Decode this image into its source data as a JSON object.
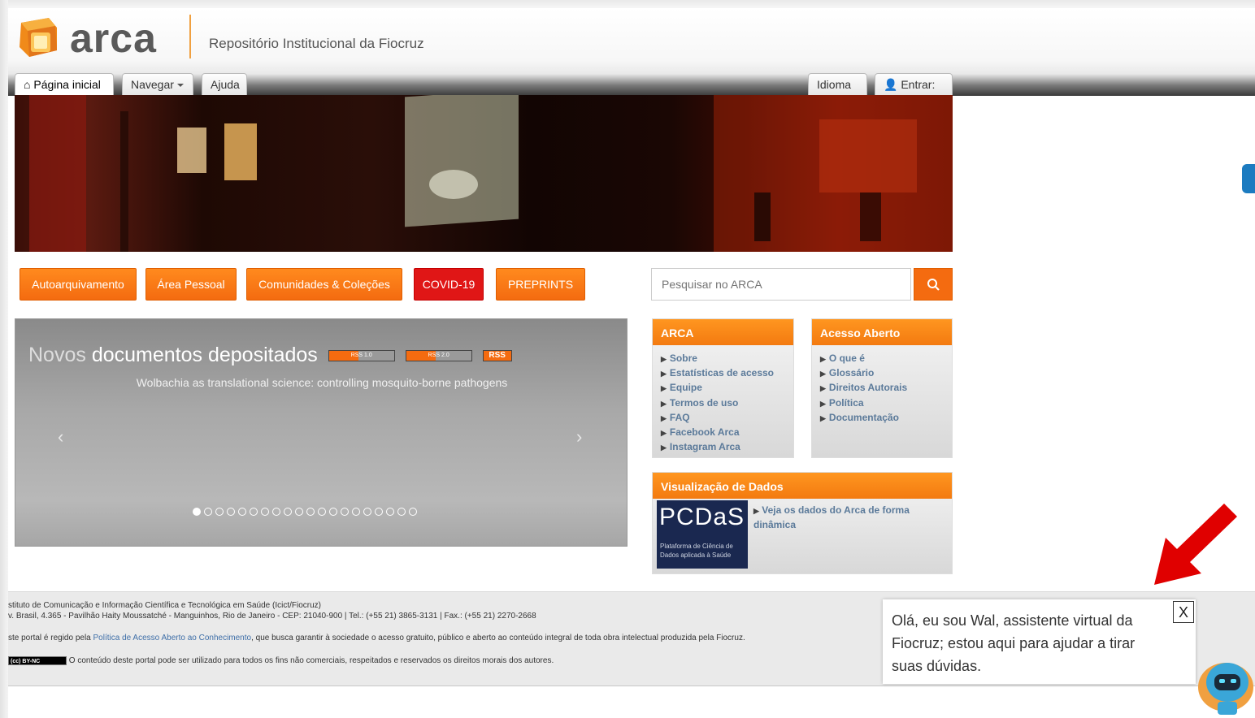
{
  "header": {
    "logo_text": "arca",
    "site_title": "Repositório Institucional da Fiocruz"
  },
  "nav": {
    "home": "Página inicial",
    "browse": "Navegar",
    "help": "Ajuda",
    "language": "Idioma",
    "login": "Entrar:"
  },
  "quick_links": [
    "Autoarquivamento",
    "Área Pessoal",
    "Comunidades & Coleções",
    "COVID-19",
    "PREPRINTS"
  ],
  "search": {
    "placeholder": "Pesquisar no ARCA"
  },
  "carousel": {
    "title_part1": "Novos",
    "title_part2": "documentos depositados",
    "rss1": "RSS 1.0",
    "rss2": "RSS 2.0",
    "rss3": "RSS",
    "item_title": "Wolbachia as translational science: controlling mosquito-borne pathogens",
    "prev": "‹",
    "next": "›",
    "slide_count": 20,
    "active_slide": 1
  },
  "panels": {
    "arca": {
      "title": "ARCA",
      "items": [
        "Sobre",
        "Estatísticas de acesso",
        "Equipe",
        "Termos de uso",
        "FAQ",
        "Facebook Arca",
        "Instagram Arca"
      ]
    },
    "open_access": {
      "title": "Acesso Aberto",
      "items": [
        "O que é",
        "Glossário",
        "Direitos Autorais",
        "Política",
        "Documentação"
      ]
    },
    "data_viz": {
      "title": "Visualização de Dados",
      "pcds_logo": "PCDaS",
      "pcds_caption_1": "Plataforma de Ciência de",
      "pcds_caption_2": "Dados aplicada à Saúde",
      "link": "Veja os dados do Arca de forma dinâmica"
    }
  },
  "footer": {
    "line1": "stituto de Comunicação e Informação Científica e Tecnológica em Saúde (Icict/Fiocruz)",
    "line2": "v. Brasil, 4.365 - Pavilhão Haity Moussatché - Manguinhos, Rio de Janeiro - CEP: 21040-900 | Tel.: (+55 21) 3865-3131 | Fax.: (+55 21) 2270-2668",
    "line3_pre": "ste portal é regido pela",
    "line3_link": "Política de Acesso Aberto ao Conhecimento",
    "line3_post": ", que busca garantir à sociedade o acesso gratuito, público e aberto ao conteúdo integral de toda obra intelectual produzida pela Fiocruz.",
    "cc_badge": "BY-NC",
    "line4": "O conteúdo deste portal pode ser utilizado para todos os fins não comerciais, respeitados e reservados os direitos morais dos autores."
  },
  "chat": {
    "message": "Olá, eu sou Wal, assistente virtual da Fiocruz; estou aqui para ajudar a tirar suas dúvidas.",
    "close": "X"
  },
  "colors": {
    "orange": "#f46b10",
    "red": "#e01616",
    "link": "#5b7a9a",
    "annotation_arrow": "#e00000"
  }
}
